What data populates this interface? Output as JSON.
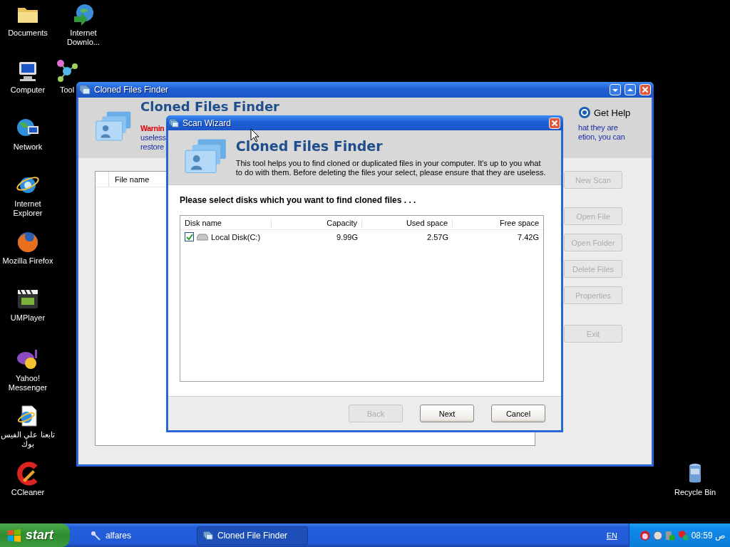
{
  "desktop_icons": [
    {
      "label": "Documents",
      "kind": "folder"
    },
    {
      "label": "Internet Downlo...",
      "kind": "download"
    },
    {
      "label": "Computer",
      "kind": "computer"
    },
    {
      "label": "Tool",
      "kind": "tools"
    },
    {
      "label": "Network",
      "kind": "network"
    },
    {
      "label": "Internet Explorer",
      "kind": "browser"
    },
    {
      "label": "Mozilla Firefox",
      "kind": "fox"
    },
    {
      "label": "UMPlayer",
      "kind": "media"
    },
    {
      "label": "Yahoo! Messenger",
      "kind": "messenger"
    },
    {
      "label": "تابعنا علي الفيس بوك",
      "kind": "webpage"
    },
    {
      "label": "CCleaner",
      "kind": "cleaner"
    },
    {
      "label": "Recycle Bin",
      "kind": "bin"
    }
  ],
  "main_window": {
    "title": "Cloned Files Finder",
    "heading": "Cloned Files Finder",
    "get_help": "Get Help",
    "warning": "Warnin",
    "left_lines": [
      "useless",
      "restore"
    ],
    "right_lines": [
      "hat they are",
      "etion, you can"
    ],
    "list_columns": [
      "File name"
    ],
    "buttons": [
      {
        "label": "New Scan",
        "disabled": true
      },
      {
        "label": "Open File",
        "disabled": true
      },
      {
        "label": "Open Folder",
        "disabled": true
      },
      {
        "label": "Delete Files",
        "disabled": true
      },
      {
        "label": "Properties",
        "disabled": true
      },
      {
        "label": "Exit",
        "disabled": true
      }
    ]
  },
  "wizard": {
    "title": "Scan Wizard",
    "heading": "Cloned Files Finder",
    "description": "This tool helps you to find cloned or duplicated files in your computer. It's up to you what to do with  them. Before deleting the files your select, please ensure that they are useless.",
    "prompt": "Please select disks which you want to find cloned files . . .",
    "columns": [
      "Disk name",
      "Capacity",
      "Used space",
      "Free space"
    ],
    "rows": [
      {
        "disk": "Local Disk(C:)",
        "capacity": "9.99G",
        "used": "2.57G",
        "free": "7.42G",
        "checked": true
      }
    ],
    "buttons": [
      {
        "label": "Back",
        "disabled": true
      },
      {
        "label": "Next",
        "disabled": false
      },
      {
        "label": "Cancel",
        "disabled": false
      }
    ]
  },
  "taskbar": {
    "start": "start",
    "quick_launch": "alfares",
    "tasks": [
      {
        "label": "Cloned File Finder",
        "selected": true
      }
    ],
    "language": "EN",
    "clock": "08:59 ص"
  }
}
